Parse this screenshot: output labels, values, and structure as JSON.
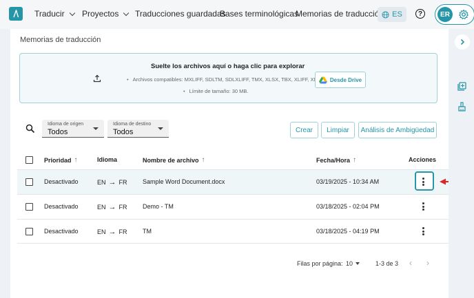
{
  "nav": {
    "items": [
      {
        "label": "Traducir",
        "dropdown": true
      },
      {
        "label": "Proyectos",
        "dropdown": true
      },
      {
        "label": "Traducciones guardadas",
        "dropdown": false
      },
      {
        "label": "Bases terminológicas",
        "dropdown": false
      },
      {
        "label": "Memorias de traducción",
        "dropdown": false
      }
    ],
    "language": "ES",
    "help": "?",
    "user_initials": "ER",
    "accent_color": "#2596a7"
  },
  "page": {
    "title": "Memorias de traducción"
  },
  "dropzone": {
    "title": "Suelte los archivos aquí o haga clic para explorar",
    "formats": "Archivos compatibles: MXLIFF, SDLTM, SDLXLIFF, TMX, XLSX, TBX, XLIFF, XML",
    "size_limit": "Límite de tamaño: 30 MB.",
    "drive_button": "Desde Drive"
  },
  "filters": {
    "source": {
      "label": "Idioma de origen",
      "value": "Todos"
    },
    "target": {
      "label": "Idioma de destino",
      "value": "Todos"
    }
  },
  "actions": {
    "create": "Crear",
    "clear": "Limpiar",
    "ambiguity": "Análisis de Ambigüedad"
  },
  "table": {
    "headers": {
      "priority": "Prioridad",
      "language": "Idioma",
      "filename": "Nombre de archivo",
      "datetime": "Fecha/Hora",
      "actions": "Acciones"
    },
    "rows": [
      {
        "priority": "Desactivado",
        "src": "EN",
        "tgt": "FR",
        "filename": "Sample Word Document.docx",
        "datetime": "03/19/2025 - 10:34 AM"
      },
      {
        "priority": "Desactivado",
        "src": "EN",
        "tgt": "FR",
        "filename": "Demo - TM",
        "datetime": "03/18/2025 - 02:04 PM"
      },
      {
        "priority": "Desactivado",
        "src": "EN",
        "tgt": "FR",
        "filename": "TM",
        "datetime": "03/18/2025 - 04:19 PM"
      }
    ]
  },
  "pagination": {
    "rows_per_page_label": "Filas por página:",
    "rows_per_page": "10",
    "range": "1-3 de 3"
  }
}
